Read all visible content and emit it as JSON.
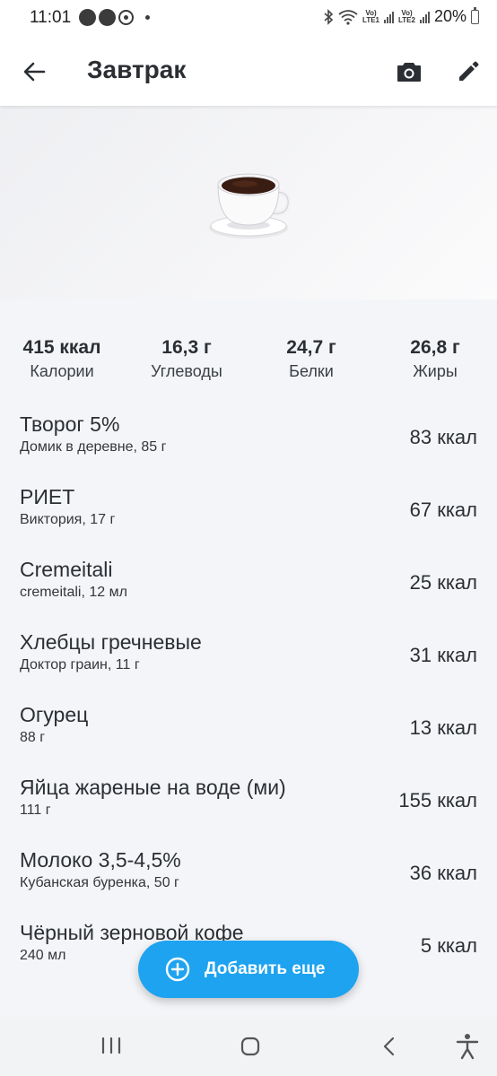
{
  "status_bar": {
    "time": "11:01",
    "volte1": "VoLTE1",
    "volte2": "VoLTE2",
    "battery": "20%"
  },
  "header": {
    "title": "Завтрак",
    "back_icon": "arrow-back-icon",
    "camera_icon": "camera-icon",
    "edit_icon": "pencil-icon"
  },
  "hero": {
    "icon": "coffee-cup-icon"
  },
  "macros": [
    {
      "value": "415 ккал",
      "label": "Калории"
    },
    {
      "value": "16,3 г",
      "label": "Углеводы"
    },
    {
      "value": "24,7 г",
      "label": "Белки"
    },
    {
      "value": "26,8 г",
      "label": "Жиры"
    }
  ],
  "foods": [
    {
      "name": "Творог 5%",
      "detail": "Домик в деревне, 85 г",
      "kcal": "83 ккал"
    },
    {
      "name": "РИЕТ",
      "detail": "Виктория, 17 г",
      "kcal": "67 ккал"
    },
    {
      "name": "Cremeitali",
      "detail": "cremeitali, 12 мл",
      "kcal": "25 ккал"
    },
    {
      "name": "Хлебцы гречневые",
      "detail": "Доктор граин, 11 г",
      "kcal": "31 ккал"
    },
    {
      "name": "Огурец",
      "detail": "88 г",
      "kcal": "13 ккал"
    },
    {
      "name": "Яйца жареные на воде (ми)",
      "detail": "111 г",
      "kcal": "155 ккал"
    },
    {
      "name": "Молоко 3,5-4,5%",
      "detail": "Кубанская буренка, 50 г",
      "kcal": "36 ккал"
    },
    {
      "name": "Чёрный зерновой кофе",
      "detail": "240 мл",
      "kcal": "5 ккал"
    }
  ],
  "fab": {
    "label": "Добавить еще",
    "icon": "plus-circle-icon"
  },
  "colors": {
    "accent": "#1ea3f0",
    "background": "#f4f5f8",
    "text": "#2b2f33"
  }
}
